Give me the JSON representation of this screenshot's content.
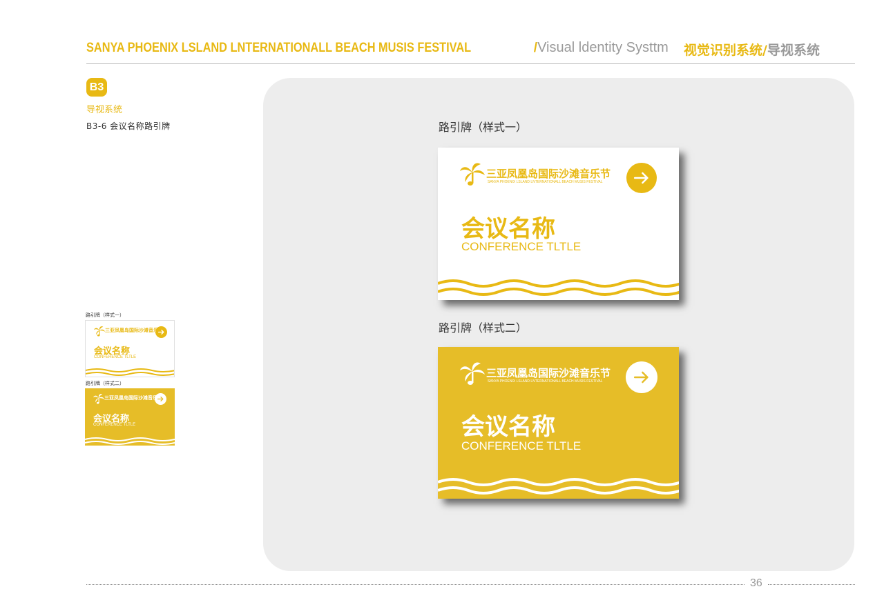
{
  "header": {
    "title_en": "SANYA PHOENIX LSLAND LNTERNATIONALL BEACH MUSIS FESTIVAL",
    "separator": "/",
    "subtitle_en": "Visual ldentity Systtm",
    "title_cn_highlight": "视觉识别系统",
    "title_cn_sep": "/",
    "title_cn_gray": "导视系统"
  },
  "section": {
    "badge": "B3",
    "title": "导视系统",
    "subsection": "B3-6 会议名称路引牌"
  },
  "signs": [
    {
      "caption": "路引牌（样式一）",
      "style": "white",
      "logo_name": "三亚凤凰岛国际沙滩音乐节",
      "logo_sub": "SANYA PHOENIX LSLAND LNTERNATIONALL BEACH MUSIS FESTIVAL",
      "title_cn": "会议名称",
      "title_en": "CONFERENCE TLTLE"
    },
    {
      "caption": "路引牌（样式二）",
      "style": "yellow",
      "logo_name": "三亚凤凰岛国际沙滩音乐节",
      "logo_sub": "SANYA PHOENIX LSLAND LNTERNATIONALL BEACH MUSIS FESTIVAL",
      "title_cn": "会议名称",
      "title_en": "CONFERENCE TLTLE"
    }
  ],
  "thumbnails": [
    {
      "caption": "路引牌（样式一）",
      "title_cn": "会议名称",
      "title_en": "CONFERENCE TLTLE"
    },
    {
      "caption": "路引牌（样式二）",
      "title_cn": "会议名称",
      "title_en": "CONFERENCE TLTLE"
    }
  ],
  "footer": {
    "page_number": "36"
  },
  "colors": {
    "accent": "#e8b914",
    "sign_yellow": "#e6bd28",
    "panel": "#ededed",
    "gray_text": "#9a9a9a"
  },
  "icons": [
    "arrow-right-icon",
    "palm-note-logo-icon"
  ]
}
